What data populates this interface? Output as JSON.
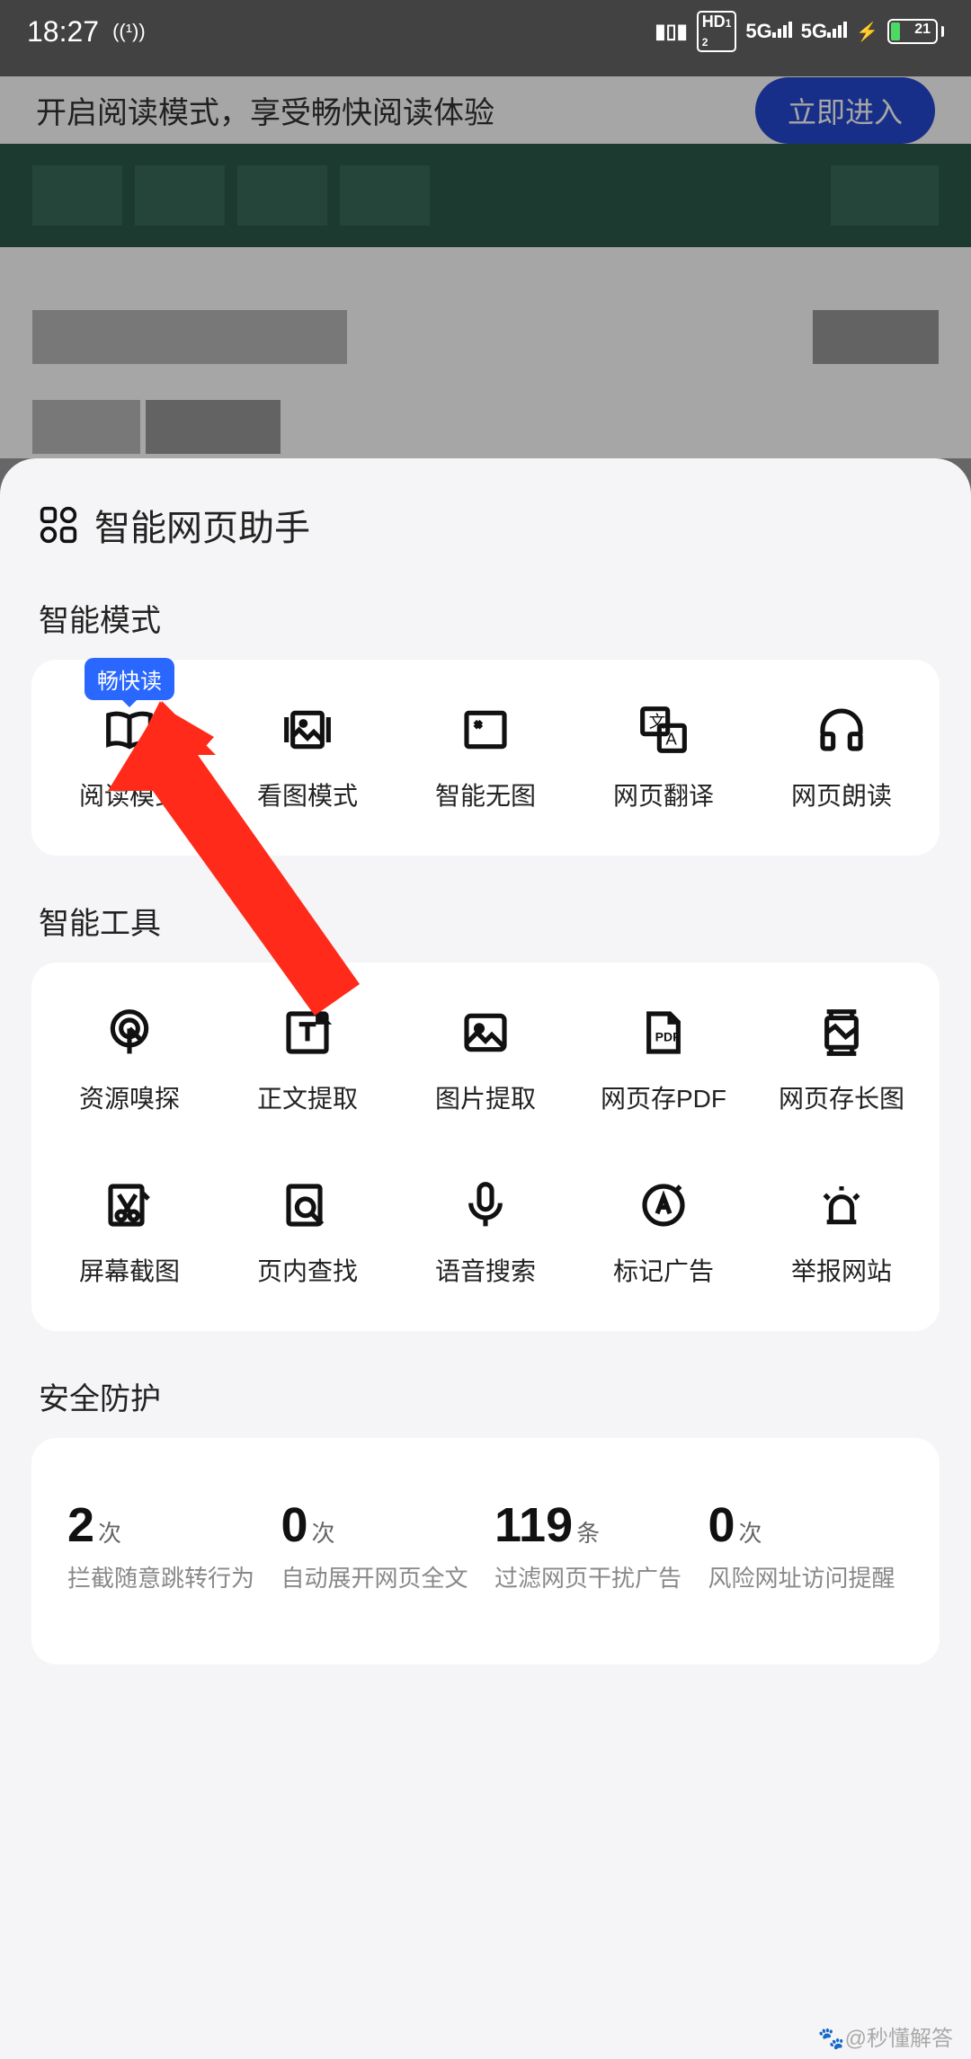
{
  "status": {
    "time": "18:27",
    "battery": "21",
    "net1": "5G",
    "net2": "5G",
    "hd": "HD"
  },
  "banner": {
    "text": "开启阅读模式，享受畅快阅读体验",
    "button": "立即进入"
  },
  "sheet": {
    "title": "智能网页助手"
  },
  "sections": {
    "modes": {
      "title": "智能模式",
      "badge": "畅快读",
      "items": [
        {
          "label": "阅读模式"
        },
        {
          "label": "看图模式"
        },
        {
          "label": "智能无图"
        },
        {
          "label": "网页翻译"
        },
        {
          "label": "网页朗读"
        }
      ]
    },
    "tools": {
      "title": "智能工具",
      "items": [
        {
          "label": "资源嗅探"
        },
        {
          "label": "正文提取"
        },
        {
          "label": "图片提取"
        },
        {
          "label": "网页存PDF"
        },
        {
          "label": "网页存长图"
        },
        {
          "label": "屏幕截图"
        },
        {
          "label": "页内查找"
        },
        {
          "label": "语音搜索"
        },
        {
          "label": "标记广告"
        },
        {
          "label": "举报网站"
        }
      ]
    },
    "security": {
      "title": "安全防护",
      "stats": [
        {
          "num": "2",
          "unit": "次",
          "label": "拦截随意跳转行为"
        },
        {
          "num": "0",
          "unit": "次",
          "label": "自动展开网页全文"
        },
        {
          "num": "119",
          "unit": "条",
          "label": "过滤网页干扰广告"
        },
        {
          "num": "0",
          "unit": "次",
          "label": "风险网址访问提醒"
        }
      ]
    }
  },
  "watermark": "@秒懂解答"
}
